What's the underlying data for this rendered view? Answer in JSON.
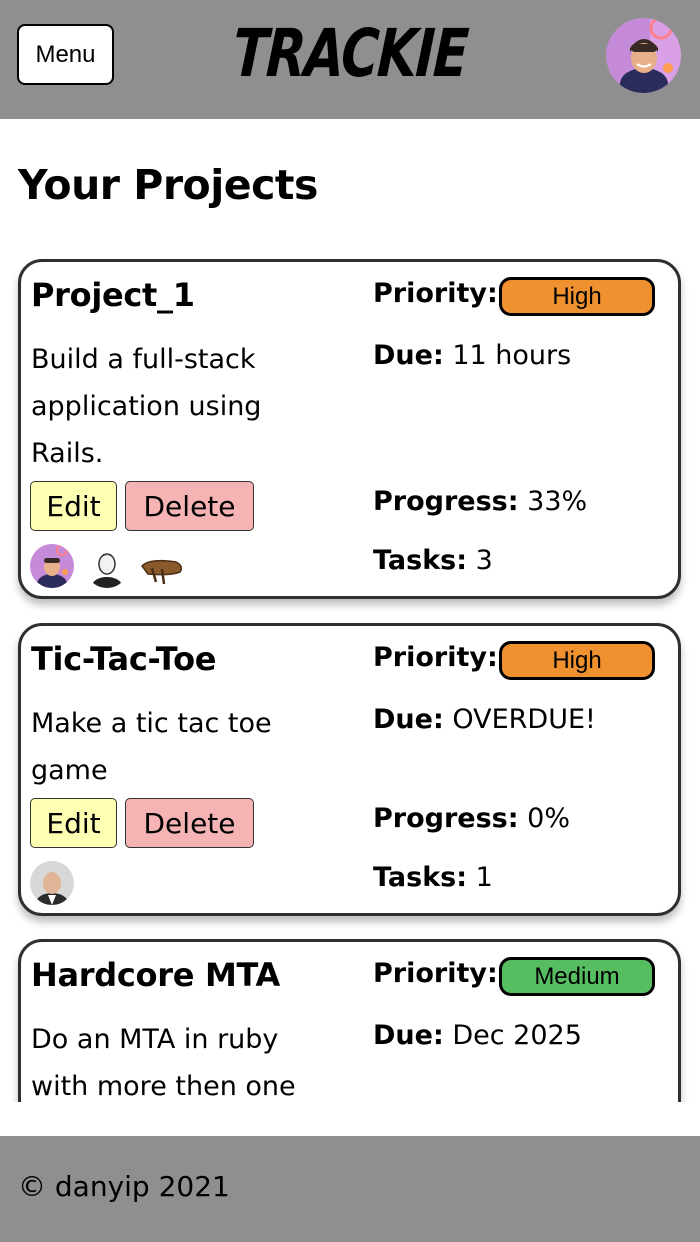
{
  "header": {
    "menu_label": "Menu",
    "logo_text": "TRACKIE",
    "bg_color": "#8f8f8f"
  },
  "main": {
    "title": "Your Projects",
    "labels": {
      "priority": "Priority:",
      "due": "Due:",
      "progress": "Progress:",
      "tasks": "Tasks:",
      "edit": "Edit",
      "delete": "Delete"
    },
    "projects": [
      {
        "name": "Project_1",
        "description": "Build a full-stack application using Rails.",
        "priority": "High",
        "priority_color": "#f0912f",
        "due": "11 hours",
        "progress": "33%",
        "tasks": "3",
        "members": [
          "person-avatar-purple",
          "person-avatar-sketch",
          "wooden-bat-avatar"
        ]
      },
      {
        "name": "Tic-Tac-Toe",
        "description": "Make a tic tac toe game",
        "priority": "High",
        "priority_color": "#f0912f",
        "due": "OVERDUE!",
        "progress": "0%",
        "tasks": "1",
        "members": [
          "older-man-avatar"
        ]
      },
      {
        "name": "Hardcore MTA",
        "description": "Do an MTA in ruby with more then one",
        "priority": "Medium",
        "priority_color": "#56bd61",
        "due": "Dec 2025"
      }
    ]
  },
  "footer": {
    "text": "© danyip 2021"
  },
  "colors": {
    "edit_button": "#ffffb3",
    "delete_button": "#f6b3b3"
  }
}
